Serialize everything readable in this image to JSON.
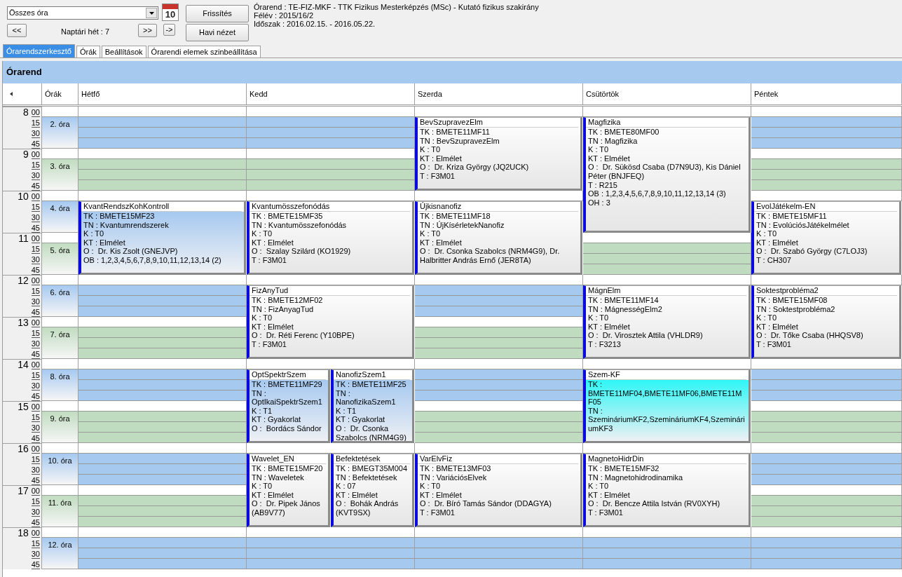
{
  "toolbar": {
    "filter_select": {
      "value": "Összes óra"
    },
    "calendar_button": {
      "day": "10"
    },
    "prev_button": "<<",
    "week_label": "Naptári hét : 7",
    "next_button": ">>",
    "go_button": "->",
    "refresh_button": "Frissítés",
    "month_button": "Havi nézet",
    "info": [
      "Órarend : TE-FIZ-MKF - TTK Fizikus Mesterképzés (MSc) - Kutató fizikus szakirány",
      "Félév : 2015/16/2",
      "Időszak : 2016.02.15. - 2016.05.22."
    ]
  },
  "tabs": [
    {
      "label": "Órarendszerkesztő",
      "selected": true
    },
    {
      "label": "Órák",
      "selected": false
    },
    {
      "label": "Beállítások",
      "selected": false
    },
    {
      "label": "Órarendi elemek szinbeállítása",
      "selected": false
    }
  ],
  "panel_title": "Órarend",
  "periods_column": "Órák",
  "hours": [
    {
      "hour": "8",
      "quarters": [
        "00",
        "15",
        "30",
        "45"
      ],
      "period": {
        "label": "2. óra",
        "color": "#a6c9f0"
      }
    },
    {
      "hour": "9",
      "quarters": [
        "00",
        "15",
        "30",
        "45"
      ],
      "period": {
        "label": "3. óra",
        "color": "#c0dcc0"
      }
    },
    {
      "hour": "10",
      "quarters": [
        "00",
        "15",
        "30",
        "45"
      ],
      "period": {
        "label": "4. óra",
        "color": "#a6c9f0"
      }
    },
    {
      "hour": "11",
      "quarters": [
        "00",
        "15",
        "30",
        "45"
      ],
      "period": {
        "label": "5. óra",
        "color": "#c0dcc0"
      }
    },
    {
      "hour": "12",
      "quarters": [
        "00",
        "15",
        "30",
        "45"
      ],
      "period": {
        "label": "6. óra",
        "color": "#a6c9f0"
      }
    },
    {
      "hour": "13",
      "quarters": [
        "00",
        "15",
        "30",
        "45"
      ],
      "period": {
        "label": "7. óra",
        "color": "#c0dcc0"
      }
    },
    {
      "hour": "14",
      "quarters": [
        "00",
        "15",
        "30",
        "45"
      ],
      "period": {
        "label": "8. óra",
        "color": "#a6c9f0"
      }
    },
    {
      "hour": "15",
      "quarters": [
        "00",
        "15",
        "30",
        "45"
      ],
      "period": {
        "label": "9. óra",
        "color": "#c0dcc0"
      }
    },
    {
      "hour": "16",
      "quarters": [
        "00",
        "15",
        "30",
        "45"
      ],
      "period": {
        "label": "10. óra",
        "color": "#a6c9f0"
      }
    },
    {
      "hour": "17",
      "quarters": [
        "00",
        "15",
        "30",
        "45"
      ],
      "period": {
        "label": "11. óra",
        "color": "#c0dcc0"
      }
    },
    {
      "hour": "18",
      "quarters": [
        "00",
        "15",
        "30",
        "45"
      ],
      "period": {
        "label": "12. óra",
        "color": "#a6c9f0"
      }
    }
  ],
  "days": [
    {
      "name": "Hétfő",
      "slots": [
        {
          "kind": "free"
        },
        {
          "kind": "free"
        },
        {
          "kind": "start",
          "events": [
            {
              "color": "#a6c9f0",
              "title": "KvantRendszKohKontroll",
              "lines": [
                "TK : BMETE15MF23",
                "TN : Kvantumrendszerek",
                "K : T0",
                "KT : Elmélet",
                "O :  Dr. Kis Zsolt (GNEJVP)",
                "OB : 1,2,3,4,5,6,7,8,9,10,11,12,13,14 (2)"
              ]
            }
          ]
        },
        {
          "kind": "continued"
        },
        {
          "kind": "free"
        },
        {
          "kind": "free"
        },
        {
          "kind": "free"
        },
        {
          "kind": "free"
        },
        {
          "kind": "free"
        },
        {
          "kind": "free"
        },
        {
          "kind": "free"
        }
      ]
    },
    {
      "name": "Kedd",
      "slots": [
        {
          "kind": "free"
        },
        {
          "kind": "free"
        },
        {
          "kind": "start",
          "events": [
            {
              "title": "Kvantumösszefonódás",
              "lines": [
                "TK : BMETE15MF35",
                "TN : Kvantumösszefonódás",
                "K : T0",
                "KT : Elmélet",
                "O :  Szalay Szilárd (KO1929)",
                "T : F3M01"
              ]
            }
          ]
        },
        {
          "kind": "continued"
        },
        {
          "kind": "start",
          "events": [
            {
              "title": "FizAnyTud",
              "lines": [
                "TK : BMETE12MF02",
                "TN : FizAnyagTud",
                "K : T0",
                "KT : Elmélet",
                "O :  Dr. Réti Ferenc (Y10BPE)",
                "T : F3M01"
              ]
            }
          ]
        },
        {
          "kind": "continued"
        },
        {
          "kind": "start",
          "events": [
            {
              "color": "#a6c9f0",
              "title": "OptSpektrSzem",
              "lines": [
                "TK : BMETE11MF29",
                "TN : OptIkaiSpektrSzem1",
                "K : T1",
                "KT : Gyakorlat",
                "O :  Bordács Sándor"
              ]
            },
            {
              "color": "#a6c9f0",
              "title": "NanofizSzem1",
              "lines": [
                "TK : BMETE11MF25",
                "TN : NanofizikaSzem1",
                "K : T1",
                "KT : Gyakorlat",
                "O :  Dr. Csonka Szabolcs (NRM4G9)"
              ]
            }
          ]
        },
        {
          "kind": "continued"
        },
        {
          "kind": "start",
          "events": [
            {
              "title": "Wavelet_EN",
              "lines": [
                "TK : BMETE15MF20",
                "TN : Waveletek",
                "K : T0",
                "KT : Elmélet",
                "O :  Dr. Pipek János (AB9V77)"
              ]
            },
            {
              "title": "Befektetések",
              "lines": [
                "TK : BMEGT35M004",
                "TN : Befektetések",
                "K : 07",
                "KT : Elmélet",
                "O :  Bohák András (KVT9SX)"
              ]
            }
          ]
        },
        {
          "kind": "continued"
        },
        {
          "kind": "free"
        }
      ]
    },
    {
      "name": "Szerda",
      "slots": [
        {
          "kind": "start",
          "events": [
            {
              "title": "BevSzupravezElm",
              "lines": [
                "TK : BMETE11MF11",
                "TN : BevSzupravezElm",
                "K : T0",
                "KT : Elmélet",
                "O :  Dr. Kriza György (JQ2UCK)",
                "T : F3M01"
              ]
            }
          ]
        },
        {
          "kind": "continued"
        },
        {
          "kind": "start",
          "events": [
            {
              "title": "Újkisnanofiz",
              "lines": [
                "TK : BMETE11MF18",
                "TN : ÚjKísérletekNanofiz",
                "K : T0",
                "KT : Elmélet",
                "O :  Dr. Csonka Szabolcs (NRM4G9), Dr. Halbritter András Ernő (JER8TA)"
              ]
            }
          ]
        },
        {
          "kind": "continued"
        },
        {
          "kind": "free"
        },
        {
          "kind": "free"
        },
        {
          "kind": "free"
        },
        {
          "kind": "free"
        },
        {
          "kind": "start",
          "events": [
            {
              "title": "VarElvFiz",
              "lines": [
                "TK : BMETE13MF03",
                "TN : VariációsElvek",
                "K : T0",
                "KT : Elmélet",
                "O :  Dr. Bíró Tamás Sándor (DDAGYA)",
                "T : F3M01"
              ]
            }
          ]
        },
        {
          "kind": "continued"
        },
        {
          "kind": "free"
        }
      ]
    },
    {
      "name": "Csütörtök",
      "slots": [
        {
          "kind": "start",
          "events": [
            {
              "title": "Magfizika",
              "lines": [
                "TK : BMETE80MF00",
                "TN : Magfizika",
                "K : T0",
                "KT : Elmélet",
                "O :  Dr. Sükösd Csaba (D7N9U3), Kis Dániel Péter (BNJFEQ)",
                "T : R215",
                "OB : 1,2,3,4,5,6,7,8,9,10,11,12,13,14 (3)",
                "OH : 3"
              ]
            }
          ]
        },
        {
          "kind": "continued"
        },
        {
          "kind": "continued"
        },
        {
          "kind": "free"
        },
        {
          "kind": "start",
          "events": [
            {
              "title": "MágnElm",
              "lines": [
                "TK : BMETE11MF14",
                "TN : MágnességElm2",
                "K : T0",
                "KT : Elmélet",
                "O :  Dr. Virosztek Attila (VHLDR9)",
                "T : F3213"
              ]
            }
          ]
        },
        {
          "kind": "continued"
        },
        {
          "kind": "start",
          "events": [
            {
              "color": "#2ff6f6",
              "title": "Szem-KF",
              "lines": [
                "TK : BMETE11MF04,BMETE11MF06,BMETE11MF05",
                "TN : SzemináriumKF2,SzemináriumKF4,SzemináriumKF3"
              ]
            }
          ]
        },
        {
          "kind": "continued"
        },
        {
          "kind": "start",
          "events": [
            {
              "title": "MagnetoHidrDin",
              "lines": [
                "TK : BMETE15MF32",
                "TN : Magnetohidrodinamika",
                "K : T0",
                "KT : Elmélet",
                "O :  Dr. Bencze Attila István (RV0XYH)",
                "T : F3M01"
              ]
            }
          ]
        },
        {
          "kind": "continued"
        },
        {
          "kind": "free"
        }
      ]
    },
    {
      "name": "Péntek",
      "slots": [
        {
          "kind": "free"
        },
        {
          "kind": "free"
        },
        {
          "kind": "start",
          "events": [
            {
              "title": "EvolJátékelm-EN",
              "lines": [
                "TK : BMETE15MF11",
                "TN : EvolúciósJátékelmélet",
                "K : T0",
                "KT : Elmélet",
                "O :  Dr. Szabó György (C7LOJ3)",
                "T : CH307"
              ]
            }
          ]
        },
        {
          "kind": "continued"
        },
        {
          "kind": "start",
          "events": [
            {
              "title": "Soktestprobléma2",
              "lines": [
                "TK : BMETE15MF08",
                "TN : Soktestprobléma2",
                "K : T0",
                "KT : Elmélet",
                "O :  Dr. Tőke Csaba (HHQSV8)",
                "T : F3M01"
              ]
            }
          ]
        },
        {
          "kind": "continued"
        },
        {
          "kind": "free"
        },
        {
          "kind": "free"
        },
        {
          "kind": "free"
        },
        {
          "kind": "free"
        },
        {
          "kind": "free"
        }
      ]
    }
  ]
}
